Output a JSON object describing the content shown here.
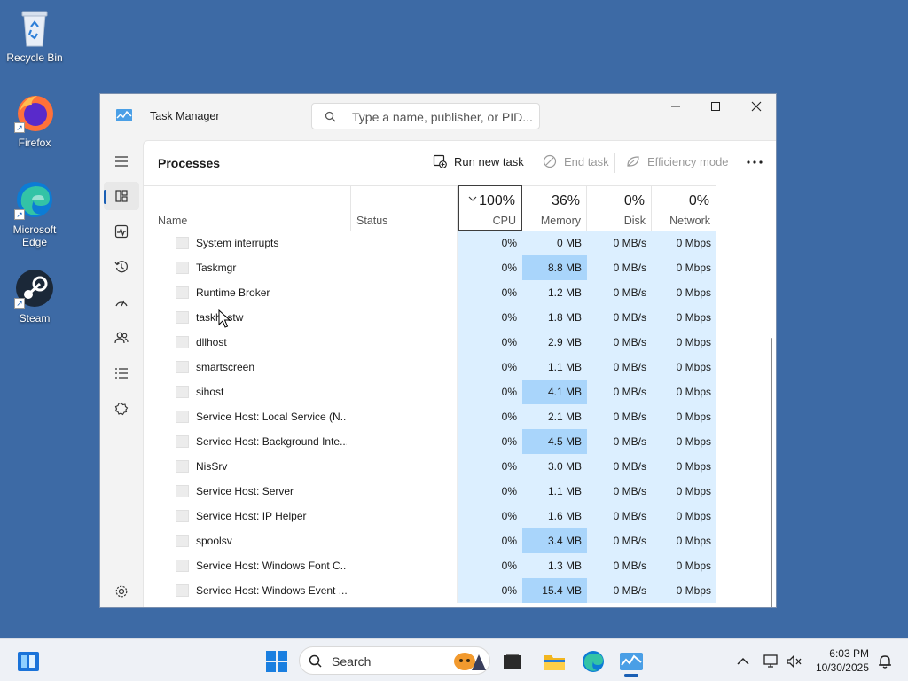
{
  "desktop": {
    "icons": [
      {
        "label": "Recycle Bin"
      },
      {
        "label": "Firefox"
      },
      {
        "label": "Microsoft Edge"
      },
      {
        "label": "Steam"
      }
    ]
  },
  "window": {
    "title": "Task Manager",
    "search_placeholder": "Type a name, publisher, or PID...",
    "page_title": "Processes",
    "commands": {
      "run_new_task": "Run new task",
      "end_task": "End task",
      "efficiency_mode": "Efficiency mode"
    },
    "columns": {
      "name": "Name",
      "status": "Status",
      "cpu": {
        "label": "CPU",
        "percent": "100%"
      },
      "memory": {
        "label": "Memory",
        "percent": "36%"
      },
      "disk": {
        "label": "Disk",
        "percent": "0%"
      },
      "network": {
        "label": "Network",
        "percent": "0%"
      }
    },
    "processes": [
      {
        "name": "System interrupts",
        "cpu": "0%",
        "memory": "0 MB",
        "disk": "0 MB/s",
        "network": "0 Mbps",
        "mem_high": false
      },
      {
        "name": "Taskmgr",
        "cpu": "0%",
        "memory": "8.8 MB",
        "disk": "0 MB/s",
        "network": "0 Mbps",
        "mem_high": true
      },
      {
        "name": "Runtime Broker",
        "cpu": "0%",
        "memory": "1.2 MB",
        "disk": "0 MB/s",
        "network": "0 Mbps",
        "mem_high": false
      },
      {
        "name": "taskhostw",
        "cpu": "0%",
        "memory": "1.8 MB",
        "disk": "0 MB/s",
        "network": "0 Mbps",
        "mem_high": false
      },
      {
        "name": "dllhost",
        "cpu": "0%",
        "memory": "2.9 MB",
        "disk": "0 MB/s",
        "network": "0 Mbps",
        "mem_high": false
      },
      {
        "name": "smartscreen",
        "cpu": "0%",
        "memory": "1.1 MB",
        "disk": "0 MB/s",
        "network": "0 Mbps",
        "mem_high": false
      },
      {
        "name": "sihost",
        "cpu": "0%",
        "memory": "4.1 MB",
        "disk": "0 MB/s",
        "network": "0 Mbps",
        "mem_high": true
      },
      {
        "name": "Service Host: Local Service (N...",
        "cpu": "0%",
        "memory": "2.1 MB",
        "disk": "0 MB/s",
        "network": "0 Mbps",
        "mem_high": false
      },
      {
        "name": "Service Host: Background Inte...",
        "cpu": "0%",
        "memory": "4.5 MB",
        "disk": "0 MB/s",
        "network": "0 Mbps",
        "mem_high": true
      },
      {
        "name": "NisSrv",
        "cpu": "0%",
        "memory": "3.0 MB",
        "disk": "0 MB/s",
        "network": "0 Mbps",
        "mem_high": false
      },
      {
        "name": "Service Host: Server",
        "cpu": "0%",
        "memory": "1.1 MB",
        "disk": "0 MB/s",
        "network": "0 Mbps",
        "mem_high": false
      },
      {
        "name": "Service Host: IP Helper",
        "cpu": "0%",
        "memory": "1.6 MB",
        "disk": "0 MB/s",
        "network": "0 Mbps",
        "mem_high": false
      },
      {
        "name": "spoolsv",
        "cpu": "0%",
        "memory": "3.4 MB",
        "disk": "0 MB/s",
        "network": "0 Mbps",
        "mem_high": true
      },
      {
        "name": "Service Host: Windows Font C...",
        "cpu": "0%",
        "memory": "1.3 MB",
        "disk": "0 MB/s",
        "network": "0 Mbps",
        "mem_high": false
      },
      {
        "name": "Service Host: Windows Event ...",
        "cpu": "0%",
        "memory": "15.4 MB",
        "disk": "0 MB/s",
        "network": "0 Mbps",
        "mem_high": true
      }
    ],
    "sidebar_icons": [
      "hamburger-menu-icon",
      "processes-icon",
      "performance-icon",
      "app-history-icon",
      "startup-apps-icon",
      "users-icon",
      "details-icon",
      "services-icon",
      "settings-icon"
    ]
  },
  "taskbar": {
    "search_placeholder": "Search",
    "time": "6:03 PM",
    "date": "10/30/2025"
  },
  "colors": {
    "desktop": "#3d6aa5",
    "accent": "#1a5fb4",
    "cpu_heat": "#dcefff",
    "mem_heat_high": "#a9d5fb"
  }
}
